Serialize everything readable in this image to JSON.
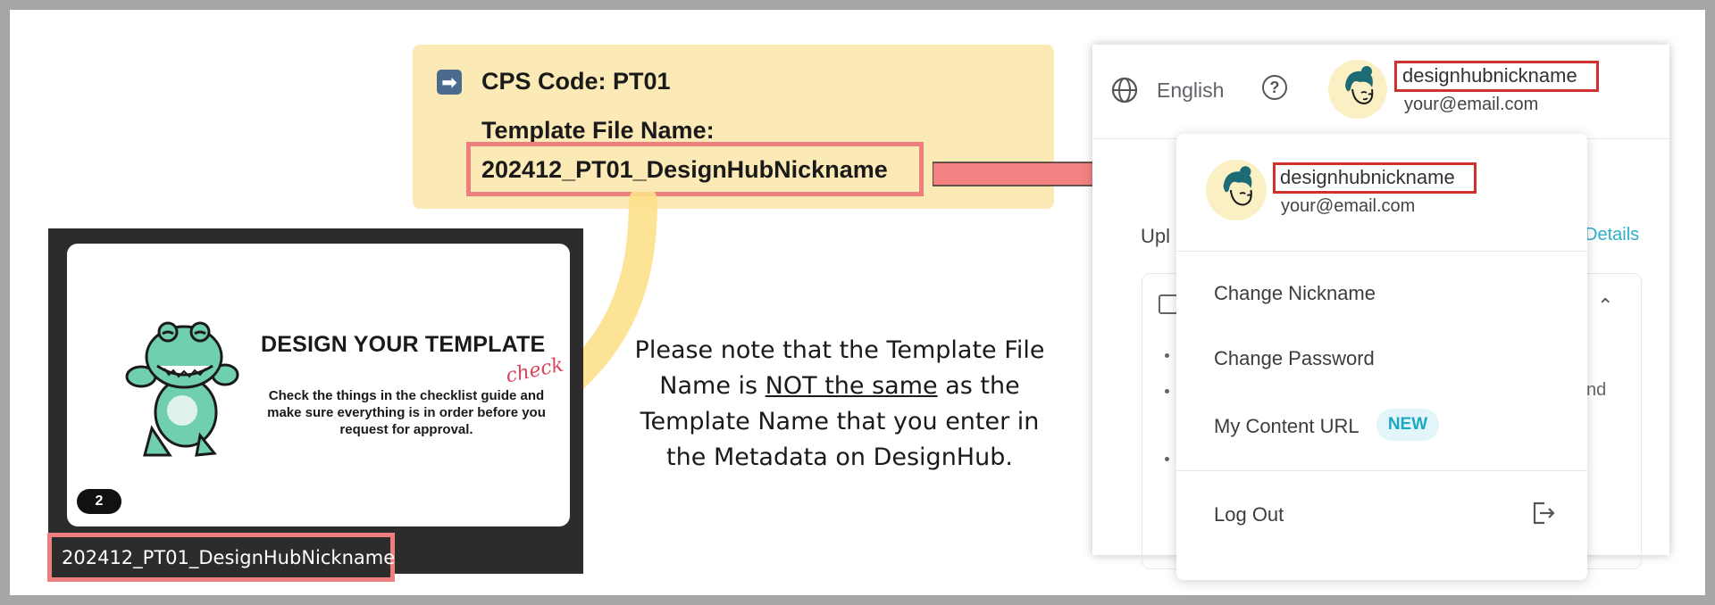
{
  "info_card": {
    "cps_code": "CPS Code: PT01",
    "template_file_name_label": "Template File Name:",
    "template_file_name_value": "202412_PT01_DesignHubNickname"
  },
  "thumbnail": {
    "title": "DESIGN YOUR TEMPLATE",
    "check_word": "check",
    "body": "Check the things in the checklist guide and make sure everything is in order before you request for approval.",
    "page_number": "2",
    "file_caption": "202412_PT01_DesignHubNickname"
  },
  "note": {
    "before": "Please note that the Template File Name is ",
    "emphasis": "NOT the same",
    "after": " as the Template Name that you enter in the Metadata on DesignHub."
  },
  "app_header": {
    "language": "English",
    "help_glyph": "?",
    "username": "designhubnickname",
    "email": "your@email.com"
  },
  "background": {
    "upload_fragment": "Upl",
    "details_fragment": "Details",
    "nd_fragment": "nd"
  },
  "dropdown": {
    "username": "designhubnickname",
    "email": "your@email.com",
    "items": {
      "change_nickname": "Change Nickname",
      "change_password": "Change Password",
      "my_content_url": "My Content URL",
      "new_badge": "NEW",
      "log_out": "Log Out"
    }
  },
  "colors": {
    "highlight_pink": "#ef7f7f",
    "highlight_red": "#d0312d",
    "card_yellow": "#fbeab5",
    "accent_cyan": "#1ba8c4"
  },
  "icons": [
    "arrow-right-icon",
    "globe-icon",
    "help-icon",
    "avatar-icon",
    "logout-icon",
    "image-icon",
    "chevron-up-icon"
  ]
}
